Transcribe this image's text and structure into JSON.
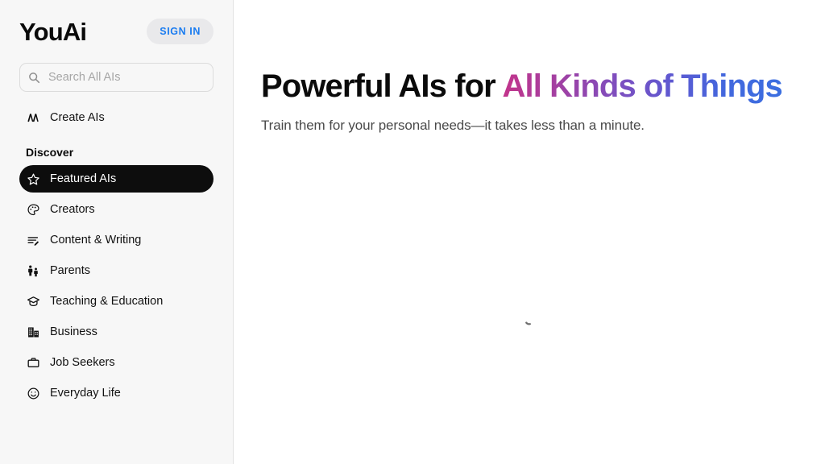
{
  "brand": {
    "logo": "YouAi"
  },
  "header": {
    "signin_label": "SIGN IN",
    "signin_text_color": "#1A7CF0",
    "signin_bg_color": "#E9E9EB"
  },
  "search": {
    "placeholder": "Search All AIs",
    "value": "",
    "icon": "search-icon"
  },
  "sidebar": {
    "top_items": [
      {
        "label": "Create AIs",
        "icon": "create-ais-icon",
        "active": false
      }
    ],
    "section_label": "Discover",
    "items": [
      {
        "label": "Featured AIs",
        "icon": "star-icon",
        "active": true
      },
      {
        "label": "Creators",
        "icon": "palette-icon",
        "active": false
      },
      {
        "label": "Content & Writing",
        "icon": "content-writing-icon",
        "active": false
      },
      {
        "label": "Parents",
        "icon": "parents-icon",
        "active": false
      },
      {
        "label": "Teaching & Education",
        "icon": "graduation-cap-icon",
        "active": false
      },
      {
        "label": "Business",
        "icon": "office-building-icon",
        "active": false
      },
      {
        "label": "Job Seekers",
        "icon": "briefcase-icon",
        "active": false
      },
      {
        "label": "Everyday Life",
        "icon": "smiley-face-icon",
        "active": false
      }
    ],
    "background_color": "#F7F7F7",
    "active_item_color": "#0D0D0D"
  },
  "main": {
    "headline_plain": "Powerful AIs for ",
    "headline_gradient": "All Kinds of Things",
    "subheadline": "Train them for your personal needs—it takes less than a minute.",
    "gradient_start_color": "#C2348B",
    "gradient_mid_color": "#6257CF",
    "gradient_end_color": "#3B6FE0",
    "loading": {
      "icon": "loading-spinner-icon",
      "color": "#6E6E6E"
    }
  }
}
